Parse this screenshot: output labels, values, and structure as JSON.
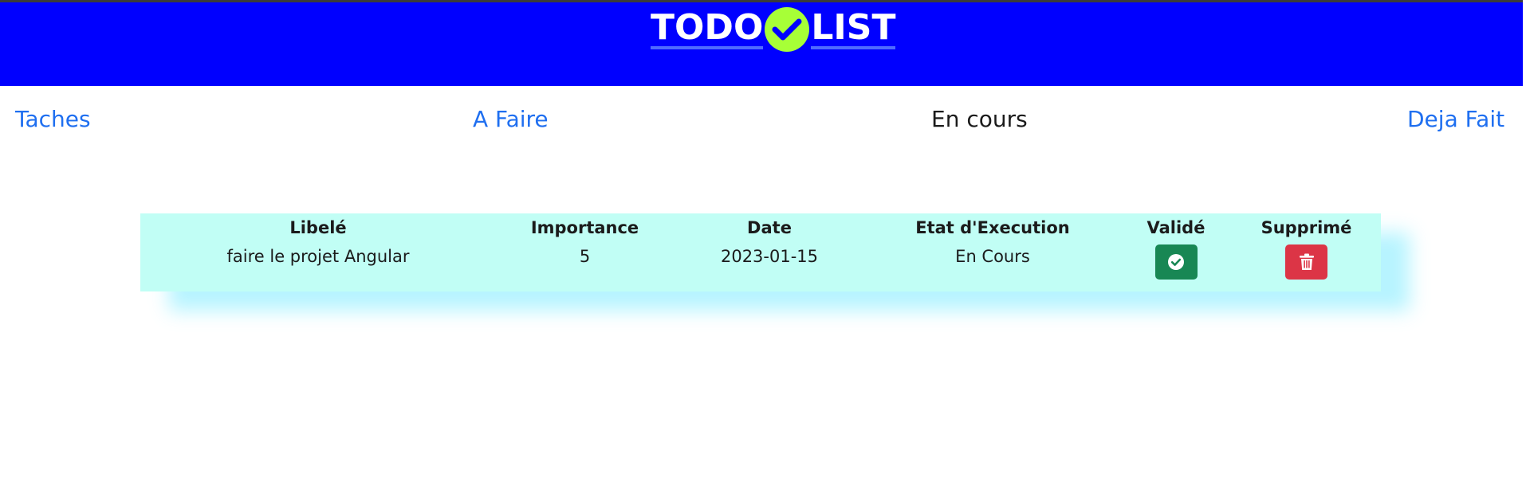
{
  "header": {
    "logo_left": "TODO",
    "logo_right": "LIST",
    "background_color": "#0000ff",
    "check_color": "#a7ff37",
    "check_icon": "check-circle-icon"
  },
  "nav": {
    "items": [
      {
        "label": "Taches",
        "active": false
      },
      {
        "label": "A Faire",
        "active": false
      },
      {
        "label": "En cours",
        "active": true
      },
      {
        "label": "Deja Fait",
        "active": false
      }
    ],
    "link_color": "#1f6ff0"
  },
  "table": {
    "background_color": "#c1fef5",
    "headers": [
      "Libelé",
      "Importance",
      "Date",
      "Etat d'Execution",
      "Validé",
      "Supprimé"
    ],
    "rows": [
      {
        "libele": "faire le projet Angular",
        "importance": "5",
        "date": "2023-01-15",
        "etat": "En Cours",
        "valide_icon": "check-circle-icon",
        "supprime_icon": "trash-icon"
      }
    ],
    "valid_button_color": "#188754",
    "delete_button_color": "#dc3546"
  }
}
